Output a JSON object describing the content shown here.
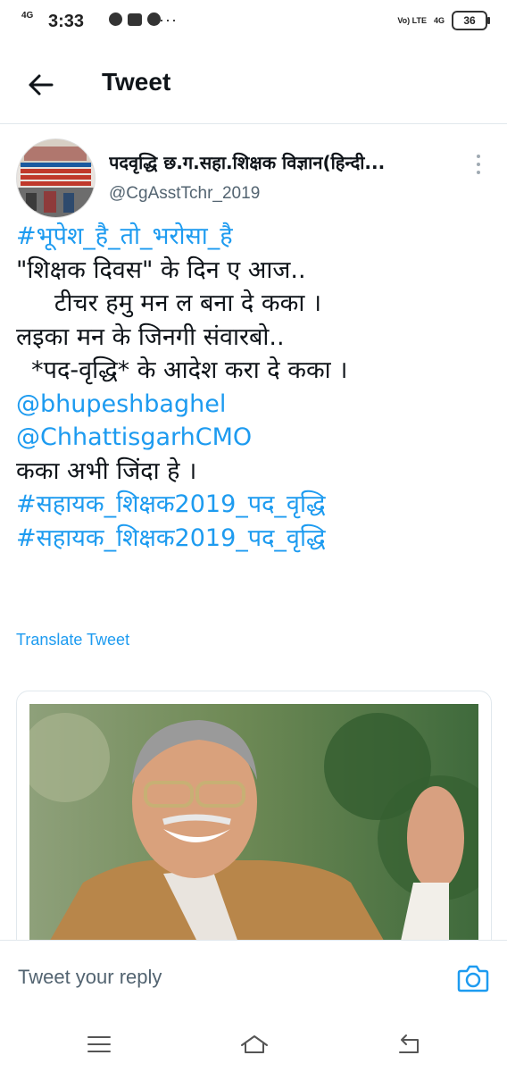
{
  "status_bar": {
    "network": "4G",
    "time": "3:33",
    "more": "···",
    "volte": "Vo) LTE",
    "signal2": "4G",
    "battery": "36"
  },
  "header": {
    "title": "Tweet"
  },
  "tweet": {
    "author_name": "पदवृद्धि छ.ग.सहा.शिक्षक विज्ञान(हिन्दी...",
    "handle": "@CgAsstTchr_2019",
    "avatar_text": [
      "सहायक शिक्षक विज्ञान भर्ती 2019 पद वृद्धि",
      "जुलाई अठवें हमर कका, हमरो सुरती आवा।",
      "पदवृद्धि कहाँ गय हो, हम दिन काहीं रहा।"
    ],
    "lines": [
      {
        "text": "#भूपेश_है_तो_भरोसा_है",
        "link": true
      },
      {
        "text": "\"शिक्षक दिवस\" के दिन ए आज..",
        "link": false
      },
      {
        "text": "     टीचर हमु मन ल बना दे कका ।",
        "link": false
      },
      {
        "text": "लइका मन के जिनगी संवारबो..",
        "link": false
      },
      {
        "text": "  *पद-वृद्धि* के आदेश करा दे कका ।",
        "link": false
      },
      {
        "text": "@bhupeshbaghel",
        "link": true
      },
      {
        "text": "@ChhattisgarhCMO",
        "link": true
      },
      {
        "text": "कका अभी जिंदा हे ।",
        "link": false
      },
      {
        "text": "#सहायक_शिक्षक2019_पद_वृद्धि",
        "link": true
      },
      {
        "text": "#सहायक_शिक्षक2019_पद_वृद्धि",
        "link": true
      }
    ],
    "translate_label": "Translate Tweet"
  },
  "reply": {
    "placeholder": "Tweet your reply"
  },
  "colors": {
    "link": "#1d9bf0",
    "muted": "#536471",
    "divider": "#e1e8ed"
  },
  "icons": [
    "back-arrow-icon",
    "more-vertical-icon",
    "camera-icon",
    "menu-icon",
    "home-icon",
    "back-nav-icon"
  ]
}
